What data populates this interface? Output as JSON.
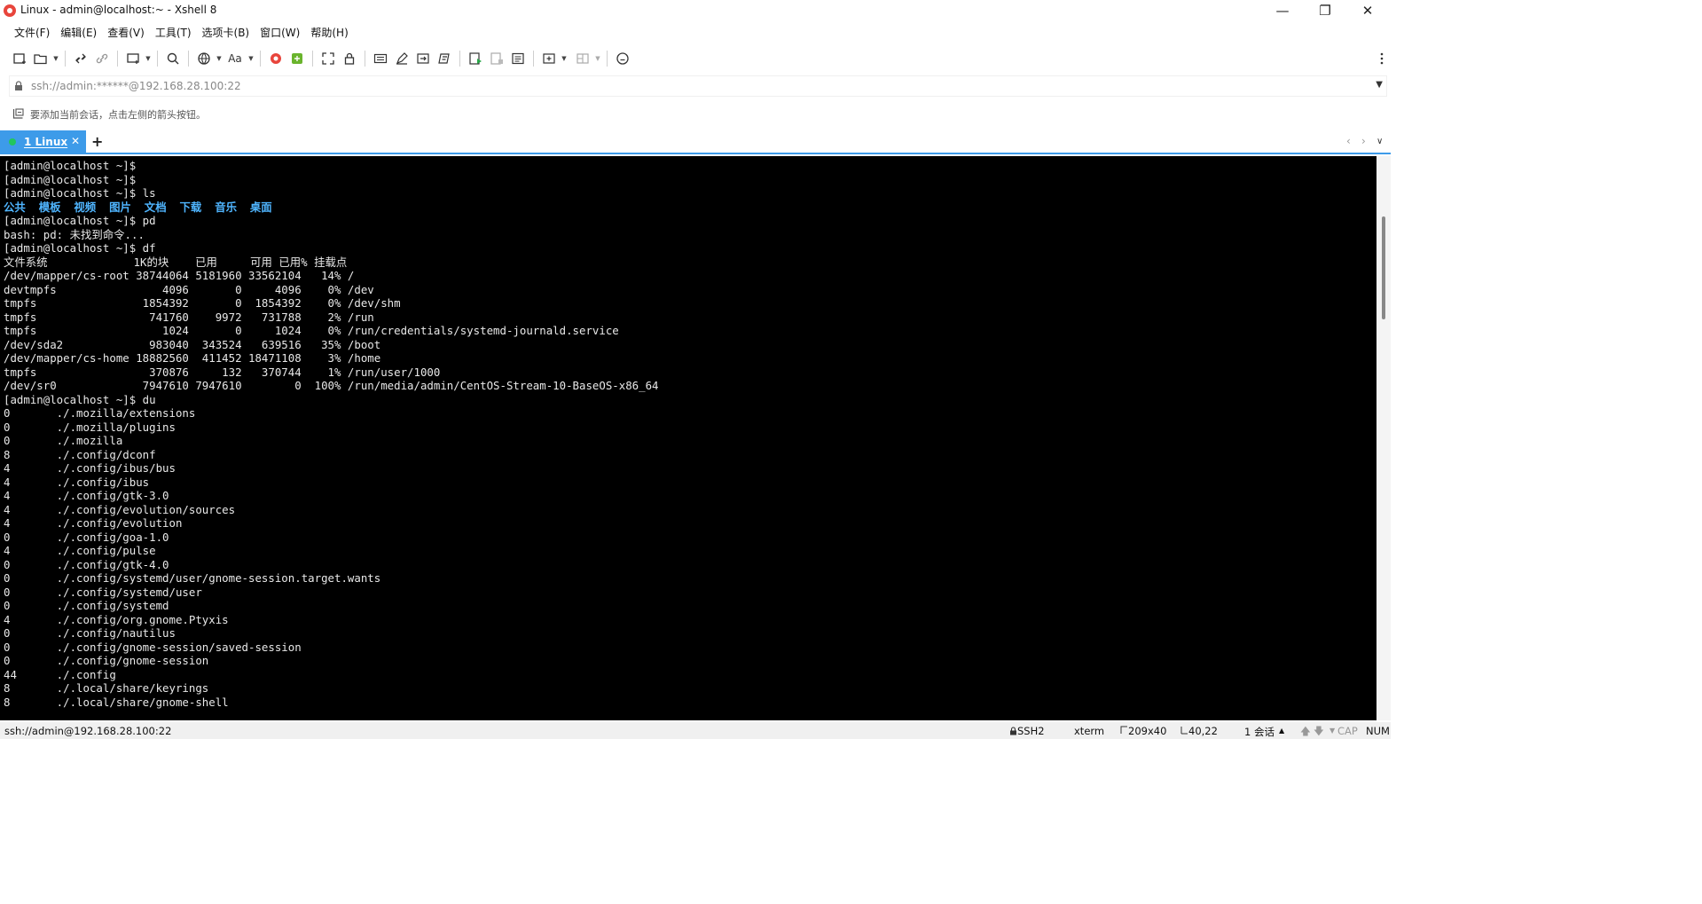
{
  "window": {
    "title": "Linux - admin@localhost:~ - Xshell 8",
    "minimize": "—",
    "maximize": "❐",
    "close": "✕"
  },
  "menu": [
    "文件(F)",
    "编辑(E)",
    "查看(V)",
    "工具(T)",
    "选项卡(B)",
    "窗口(W)",
    "帮助(H)"
  ],
  "address": {
    "value": "ssh://admin:******@192.168.28.100:22"
  },
  "hint": "要添加当前会话，点击左侧的箭头按钮。",
  "tabs": [
    {
      "label": "1 Linux",
      "active": true
    }
  ],
  "tab_add": "+",
  "tab_close": "✕",
  "terminal": {
    "lines": [
      "[admin@localhost ~]$",
      "[admin@localhost ~]$",
      "[admin@localhost ~]$ ls",
      "公共  模板  视频  图片  文档  下载  音乐  桌面",
      "[admin@localhost ~]$ pd",
      "bash: pd: 未找到命令...",
      "[admin@localhost ~]$ df",
      "文件系统             1K的块    已用     可用 已用% 挂载点",
      "/dev/mapper/cs-root 38744064 5181960 33562104   14% /",
      "devtmpfs                4096       0     4096    0% /dev",
      "tmpfs                1854392       0  1854392    0% /dev/shm",
      "tmpfs                 741760    9972   731788    2% /run",
      "tmpfs                   1024       0     1024    0% /run/credentials/systemd-journald.service",
      "/dev/sda2             983040  343524   639516   35% /boot",
      "/dev/mapper/cs-home 18882560  411452 18471108    3% /home",
      "tmpfs                 370876     132   370744    1% /run/user/1000",
      "/dev/sr0             7947610 7947610        0  100% /run/media/admin/CentOS-Stream-10-BaseOS-x86_64",
      "[admin@localhost ~]$ du",
      "0       ./.mozilla/extensions",
      "0       ./.mozilla/plugins",
      "0       ./.mozilla",
      "8       ./.config/dconf",
      "4       ./.config/ibus/bus",
      "4       ./.config/ibus",
      "4       ./.config/gtk-3.0",
      "4       ./.config/evolution/sources",
      "4       ./.config/evolution",
      "0       ./.config/goa-1.0",
      "4       ./.config/pulse",
      "0       ./.config/gtk-4.0",
      "0       ./.config/systemd/user/gnome-session.target.wants",
      "0       ./.config/systemd/user",
      "0       ./.config/systemd",
      "4       ./.config/org.gnome.Ptyxis",
      "0       ./.config/nautilus",
      "0       ./.config/gnome-session/saved-session",
      "0       ./.config/gnome-session",
      "44      ./.config",
      "8       ./.local/share/keyrings",
      "8       ./.local/share/gnome-shell"
    ],
    "dir_color": "#4fb5ff",
    "text_color": "#e8e8e8",
    "background": "#000000"
  },
  "status": {
    "connection": "ssh://admin@192.168.28.100:22",
    "protocol": "SSH2",
    "term_type": "xterm",
    "size": "209x40",
    "cursor": "40,22",
    "sessions": "1 会话",
    "cap": "CAP",
    "num": "NUM"
  },
  "colors": {
    "accent": "#3d9be9",
    "tab_dot": "#22c65e"
  }
}
